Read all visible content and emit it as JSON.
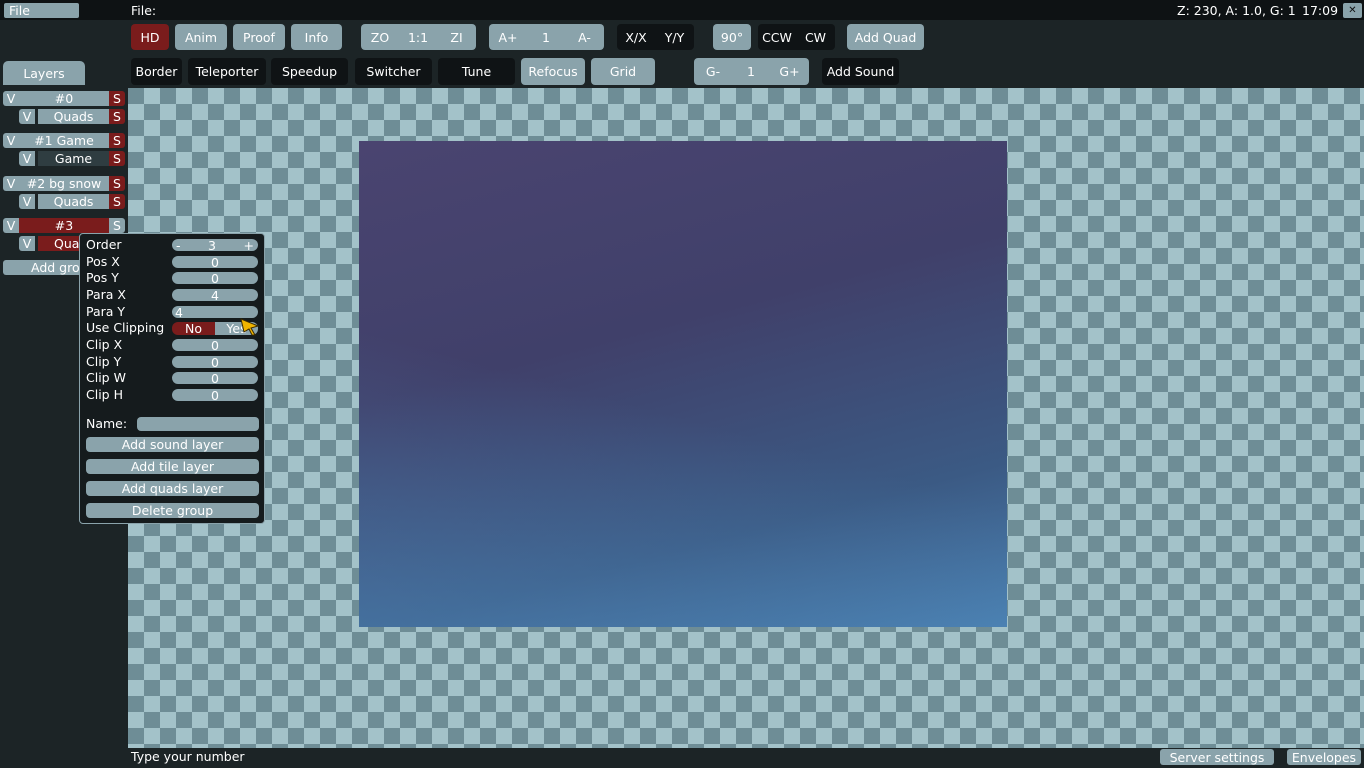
{
  "menubar": {
    "file_menu": "File",
    "file_label": "File:",
    "status": "Z: 230, A: 1.0, G: 1",
    "clock": "17:09",
    "close_glyph": "✕"
  },
  "toolbar1": {
    "hd": "HD",
    "anim": "Anim",
    "proof": "Proof",
    "info": "Info",
    "zoom_out": "ZO",
    "zoom_reset": "1:1",
    "zoom_in": "ZI",
    "anim_faster": "A+",
    "anim_speed": "1",
    "anim_slower": "A-",
    "flip_x": "X/X",
    "flip_y": "Y/Y",
    "rotate_90": "90°",
    "ccw": "CCW",
    "cw": "CW",
    "add_quad": "Add Quad"
  },
  "toolbar2": {
    "border": "Border",
    "teleporter": "Teleporter",
    "speedup": "Speedup",
    "switcher": "Switcher",
    "tune": "Tune",
    "refocus": "Refocus",
    "grid": "Grid",
    "grid_smaller": "G-",
    "grid_factor": "1",
    "grid_bigger": "G+",
    "add_sound": "Add Sound"
  },
  "layers_panel": {
    "tab": "Layers",
    "visible_glyph": "V",
    "solo_glyph": "S",
    "groups": [
      {
        "name": "#0",
        "layers": [
          "Quads"
        ]
      },
      {
        "name": "#1 Game",
        "layers": [
          "Game"
        ]
      },
      {
        "name": "#2 bg snow",
        "layers": [
          "Quads"
        ]
      },
      {
        "name": "#3",
        "layers": [
          "Quads"
        ]
      }
    ],
    "add_group": "Add group"
  },
  "group_popup": {
    "order_label": "Order",
    "order_minus": "-",
    "order_value": "3",
    "order_plus": "+",
    "pos_x_label": "Pos X",
    "pos_x": "0",
    "pos_y_label": "Pos Y",
    "pos_y": "0",
    "para_x_label": "Para X",
    "para_x": "4",
    "para_y_label": "Para Y",
    "para_y": "4",
    "use_clipping_label": "Use Clipping",
    "clip_no": "No",
    "clip_yes": "Yes",
    "clip_x_label": "Clip X",
    "clip_x": "0",
    "clip_y_label": "Clip Y",
    "clip_y": "0",
    "clip_w_label": "Clip W",
    "clip_w": "0",
    "clip_h_label": "Clip H",
    "clip_h": "0",
    "name_label": "Name:",
    "name_value": "",
    "add_sound_layer": "Add sound layer",
    "add_tile_layer": "Add tile layer",
    "add_quads_layer": "Add quads layer",
    "delete_group": "Delete group"
  },
  "statusbar": {
    "hint": "Type your number",
    "server_settings": "Server settings",
    "envelopes": "Envelopes"
  },
  "colors": {
    "button": "#8aa3ab",
    "dark_button": "#0f1315",
    "selected": "#7a1c1c",
    "background": "#1c2426"
  },
  "icons": {
    "cursor": "pointer-arrow-icon"
  }
}
